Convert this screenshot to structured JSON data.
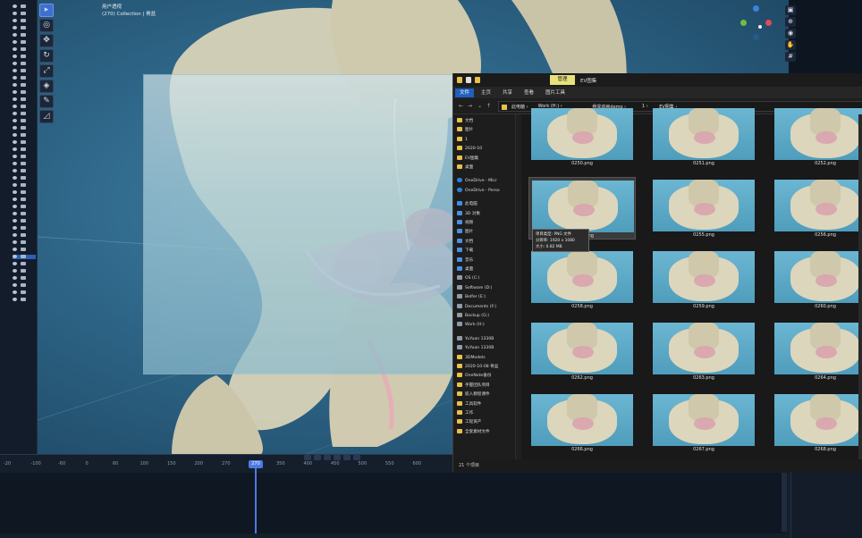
{
  "viewport": {
    "info_line1": "用户透视",
    "info_line2": "(270) Collection | 骨盆",
    "tools": [
      "select",
      "cursor",
      "move",
      "rotate",
      "scale",
      "transform",
      "annotate",
      "measure"
    ]
  },
  "timeline": {
    "current_frame": "270",
    "ticks": [
      "-20",
      "-100",
      "-60",
      "0",
      "60",
      "100",
      "150",
      "200",
      "270",
      "300",
      "350",
      "400",
      "450",
      "500",
      "550",
      "600"
    ]
  },
  "explorer": {
    "manage_tab": "管理",
    "window_title": "EV图集",
    "ribbon_tabs": [
      "文件",
      "主页",
      "共享",
      "查看",
      "图片工具"
    ],
    "path": [
      "此电脑",
      "Work (H:)",
      "骨盆动画demo",
      "1",
      "EV图集"
    ],
    "nav_items": [
      {
        "label": "文档",
        "icon": "folder-icon"
      },
      {
        "label": "图片",
        "icon": "folder-icon"
      },
      {
        "label": "1",
        "icon": "folder-icon"
      },
      {
        "label": "2020-10",
        "icon": "folder-icon"
      },
      {
        "label": "EV图集",
        "icon": "folder-icon"
      },
      {
        "label": "桌面",
        "icon": "folder-icon"
      },
      {
        "label": "OneDrive - Micr",
        "icon": "cloud-icon"
      },
      {
        "label": "OneDrive - Perso",
        "icon": "cloud-icon"
      },
      {
        "label": "此电脑",
        "icon": "pc-icon"
      },
      {
        "label": "3D 对象",
        "icon": "blue-icon"
      },
      {
        "label": "视频",
        "icon": "blue-icon"
      },
      {
        "label": "图片",
        "icon": "blue-icon"
      },
      {
        "label": "文档",
        "icon": "blue-icon"
      },
      {
        "label": "下载",
        "icon": "blue-icon"
      },
      {
        "label": "音乐",
        "icon": "blue-icon"
      },
      {
        "label": "桌面",
        "icon": "blue-icon"
      },
      {
        "label": "OS (C:)",
        "icon": "drive-icon"
      },
      {
        "label": "Software (D:)",
        "icon": "drive-icon"
      },
      {
        "label": "Belfer (E:)",
        "icon": "drive-icon"
      },
      {
        "label": "Documents (F:)",
        "icon": "drive-icon"
      },
      {
        "label": "Backup (G:)",
        "icon": "drive-icon"
      },
      {
        "label": "Work (H:)",
        "icon": "drive-icon"
      },
      {
        "label": "YuYuan 1330B",
        "icon": "drive-icon"
      },
      {
        "label": "YuYuan 1330B",
        "icon": "drive-icon"
      },
      {
        "label": "3DModels",
        "icon": "folder-icon"
      },
      {
        "label": "2020-10-08 骨盆",
        "icon": "folder-icon"
      },
      {
        "label": "OneNote备份",
        "icon": "folder-icon"
      },
      {
        "label": "手握团队项目",
        "icon": "folder-icon"
      },
      {
        "label": "嵌入教程课件",
        "icon": "folder-icon"
      },
      {
        "label": "工具软件",
        "icon": "folder-icon"
      },
      {
        "label": "工作",
        "icon": "folder-icon"
      },
      {
        "label": "工程资产",
        "icon": "folder-icon"
      },
      {
        "label": "全套素材文件",
        "icon": "folder-icon"
      }
    ],
    "files": [
      "0250.png",
      "0251.png",
      "0252.png",
      "0254.png",
      "0255.png",
      "0256.png",
      "0258.png",
      "0259.png",
      "0260.png",
      "0262.png",
      "0263.png",
      "0264.png",
      "0266.png",
      "0267.png",
      "0268.png"
    ],
    "tooltip": {
      "line1": "项目类型: PNG 文件",
      "line2": "分辨率: 1920 x 1080",
      "line3": "大小: 0.82 MB"
    },
    "status": "21 个项目"
  }
}
